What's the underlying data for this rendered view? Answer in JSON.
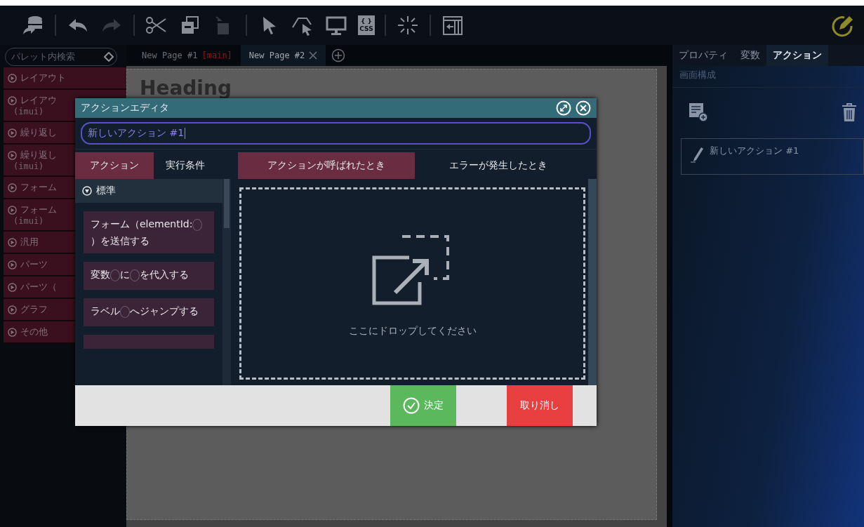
{
  "toolbar": {
    "tools": [
      {
        "kind": "database",
        "disabled": false
      },
      {
        "kind": "sep"
      },
      {
        "kind": "undo",
        "disabled": false
      },
      {
        "kind": "redo",
        "disabled": true
      },
      {
        "kind": "sep"
      },
      {
        "kind": "cut",
        "disabled": false
      },
      {
        "kind": "copy",
        "disabled": false
      },
      {
        "kind": "paste",
        "disabled": true
      },
      {
        "kind": "sep"
      },
      {
        "kind": "pointer",
        "disabled": false
      },
      {
        "kind": "select",
        "disabled": false
      },
      {
        "kind": "monitor",
        "disabled": false
      },
      {
        "kind": "css",
        "disabled": false,
        "label": "{ }\nCSS"
      },
      {
        "kind": "sep"
      },
      {
        "kind": "sparkle",
        "disabled": false
      },
      {
        "kind": "sep"
      },
      {
        "kind": "panel",
        "disabled": false
      }
    ]
  },
  "palette": {
    "search": {
      "placeholder": "パレット内検索"
    },
    "items": [
      {
        "label": "レイアウト"
      },
      {
        "label": "レイアウ",
        "sub": "(imui)"
      },
      {
        "label": "繰り返し"
      },
      {
        "label": "繰り返し",
        "sub": "(imui)"
      },
      {
        "label": "フォーム"
      },
      {
        "label": "フォーム",
        "sub": "(imui)"
      },
      {
        "label": "汎用"
      },
      {
        "label": "パーツ"
      },
      {
        "label": "パーツ（"
      },
      {
        "label": "グラフ"
      },
      {
        "label": "その他"
      }
    ]
  },
  "page_tabs": [
    {
      "label": "New Page #1",
      "tag": "[main]",
      "selected": false,
      "closable": false
    },
    {
      "label": "New Page #2",
      "selected": true,
      "closable": true
    }
  ],
  "canvas": {
    "heading": "Heading"
  },
  "right_panel": {
    "tabs": [
      {
        "label": "プロパティ",
        "selected": false
      },
      {
        "label": "変数",
        "selected": false
      },
      {
        "label": "アクション",
        "selected": true
      }
    ],
    "subtitle": "画面構成",
    "actions": [
      {
        "label": "新しいアクション #1"
      }
    ]
  },
  "dialog": {
    "title": "アクションエディタ",
    "name_value": "新しいアクション #1",
    "left_tabs": [
      {
        "label": "アクション",
        "selected": true
      },
      {
        "label": "実行条件",
        "selected": false
      }
    ],
    "right_tabs": [
      {
        "label": "アクションが呼ばれたとき",
        "selected": true
      },
      {
        "label": "エラーが発生したとき",
        "selected": false
      }
    ],
    "group": {
      "label": "標準",
      "expanded": true
    },
    "blocks": [
      {
        "parts": [
          {
            "kind": "text",
            "text": "フォーム（elementId:"
          },
          {
            "kind": "slot"
          },
          {
            "kind": "text",
            "text": "）を送信する"
          }
        ]
      },
      {
        "parts": [
          {
            "kind": "text",
            "text": "変数"
          },
          {
            "kind": "slot"
          },
          {
            "kind": "text",
            "text": "に"
          },
          {
            "kind": "slot"
          },
          {
            "kind": "text",
            "text": "を代入する"
          }
        ]
      },
      {
        "parts": [
          {
            "kind": "text",
            "text": "ラベル"
          },
          {
            "kind": "slot"
          },
          {
            "kind": "text",
            "text": "へジャンプする"
          }
        ]
      }
    ],
    "drop_hint": "ここにドロップしてください",
    "buttons": [
      {
        "kind": "ok",
        "label": "決定"
      },
      {
        "kind": "cancel",
        "label": "取り消し"
      }
    ]
  }
}
